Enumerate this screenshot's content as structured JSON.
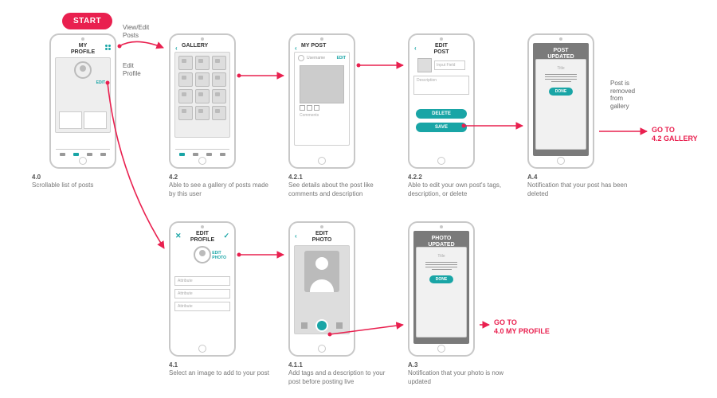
{
  "start": "START",
  "sideLabels": {
    "viewEdit": "View/Edit\nPosts",
    "editProfile": "Edit\nProfile",
    "postRemoved": "Post is\nremoved\nfrom\ngallery"
  },
  "gotos": {
    "gallery": "GO TO\n4.2 GALLERY",
    "profile": "GO TO\n4.0 MY PROFILE"
  },
  "cards": {
    "profile": {
      "title": "MY\nPROFILE",
      "edit": "EDIT",
      "caption_id": "4.0",
      "caption": "Scrollable list of posts"
    },
    "gallery": {
      "title": "GALLERY",
      "caption_id": "4.2",
      "caption": "Able to see a gallery of posts made by this user"
    },
    "mypost": {
      "title": "MY POST",
      "edit": "EDIT",
      "user": "Username",
      "comments": "Comments",
      "caption_id": "4.2.1",
      "caption": "See details about the post like comments and description"
    },
    "editpost": {
      "title": "EDIT\nPOST",
      "field": "Input Field",
      "desc": "Description",
      "delete": "DELETE",
      "save": "SAVE",
      "caption_id": "4.2.2",
      "caption": "Able to edit your own post's tags, description, or delete"
    },
    "postupdated": {
      "title": "POST\nUPDATED",
      "modal_title": "Title",
      "done": "DONE",
      "caption_id": "A.4",
      "caption": "Notification that your post has been deleted"
    },
    "editprofile": {
      "title": "EDIT\nPROFILE",
      "editphoto": "EDIT\nPHOTO",
      "attr": "Attribute",
      "caption_id": "4.1",
      "caption": "Select an image to add to your post"
    },
    "editphoto": {
      "title": "EDIT\nPHOTO",
      "caption_id": "4.1.1",
      "caption": "Add tags and a description to your post before posting live"
    },
    "photoupdated": {
      "title": "PHOTO\nUPDATED",
      "modal_title": "Title",
      "done": "DONE",
      "caption_id": "A.3",
      "caption": "Notification that your photo is now updated"
    }
  }
}
